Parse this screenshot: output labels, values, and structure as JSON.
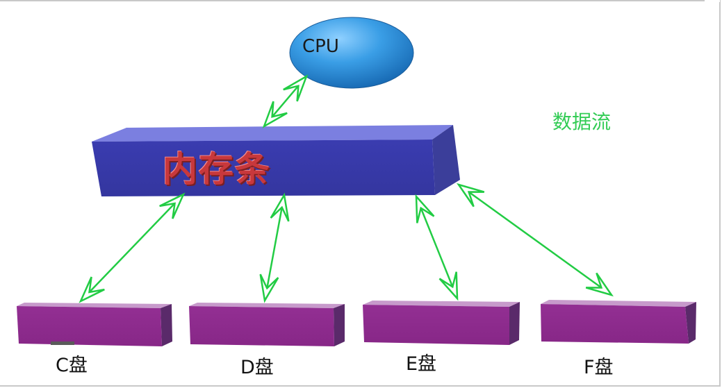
{
  "cpu": {
    "label": "CPU",
    "color": "#2b8fd8"
  },
  "memory": {
    "label": "内存条",
    "color": "#3d3fb5"
  },
  "legend": {
    "data_flow": "数据流",
    "color": "#22cc44"
  },
  "disks": [
    {
      "label": "C盘"
    },
    {
      "label": "D盘"
    },
    {
      "label": "E盘"
    },
    {
      "label": "F盘"
    }
  ],
  "disk_color": "#8e2d8e"
}
